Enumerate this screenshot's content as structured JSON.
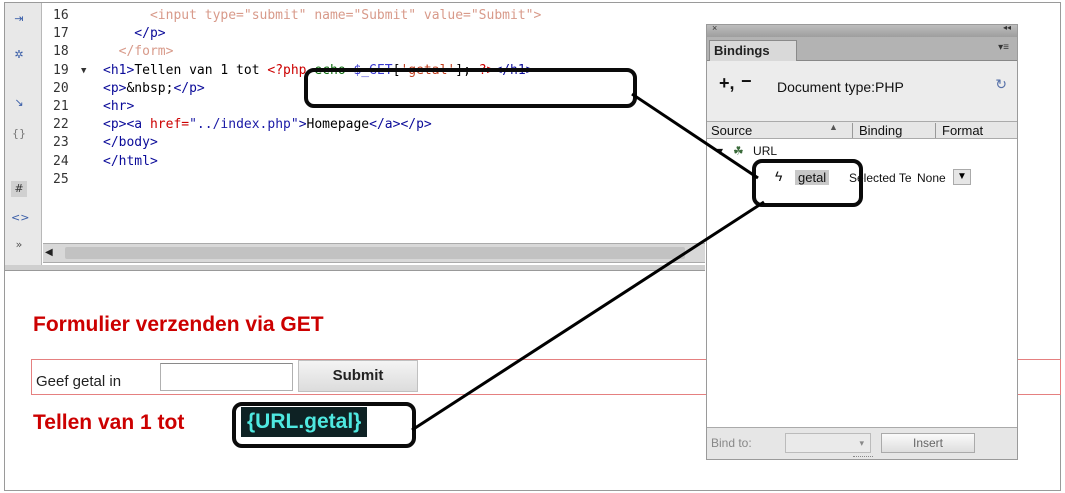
{
  "toolbar": {
    "icons": [
      "expand-icon",
      "collapse-icon",
      "select-parent-icon",
      "balance-braces-icon",
      "line-numbers-icon",
      "highlight-invalid-icon",
      "more-icon"
    ]
  },
  "code": {
    "lines": [
      {
        "num": "16",
        "parts": [
          [
            "faded",
            "      <input type=\"submit\" name=\"Submit\" value=\"Submit\">"
          ]
        ]
      },
      {
        "num": "17",
        "parts": [
          [
            "tag",
            "    </p>"
          ]
        ]
      },
      {
        "num": "18",
        "parts": [
          [
            "faded",
            "  </form>"
          ]
        ]
      },
      {
        "num": "19",
        "parts": [
          [
            "tag",
            "<h1>"
          ],
          [
            "plain",
            "Tellen van 1 tot "
          ],
          [
            "php",
            "<?php "
          ],
          [
            "phpfn",
            "echo "
          ],
          [
            "phpvar",
            "$_GET"
          ],
          [
            "plain",
            "["
          ],
          [
            "phpstr",
            "'getal'"
          ],
          [
            "plain",
            "]; "
          ],
          [
            "php",
            "?>"
          ],
          [
            "tag",
            "</h1>"
          ]
        ]
      },
      {
        "num": "20",
        "parts": [
          [
            "tag",
            "<p>"
          ],
          [
            "plain",
            "&nbsp;"
          ],
          [
            "tag",
            "</p>"
          ]
        ]
      },
      {
        "num": "21",
        "parts": [
          [
            "tag",
            "<hr>"
          ]
        ]
      },
      {
        "num": "22",
        "parts": [
          [
            "tag",
            "<p><a "
          ],
          [
            "kw",
            "href="
          ],
          [
            "str",
            "\"../index.php\""
          ],
          [
            "tag",
            ">"
          ],
          [
            "plain",
            "Homepage"
          ],
          [
            "tag",
            "</a></p>"
          ]
        ]
      },
      {
        "num": "23",
        "parts": [
          [
            "tag",
            "</body>"
          ]
        ]
      },
      {
        "num": "24",
        "parts": [
          [
            "tag",
            "</html>"
          ]
        ]
      },
      {
        "num": "25",
        "parts": []
      }
    ]
  },
  "design": {
    "heading": "Formulier verzenden via GET",
    "form_label": "Geef getal in",
    "form_input_value": "",
    "submit_label": "Submit",
    "result_prefix": "Tellen van 1 tot ",
    "result_token": "{URL.getal}"
  },
  "panel": {
    "title": "Bindings",
    "doc_type": "Document type:PHP",
    "add_label": "+,",
    "remove_label": "−",
    "columns": {
      "source": "Source",
      "binding": "Binding",
      "format": "Format"
    },
    "tree": {
      "url_label": "URL",
      "item": {
        "name": "getal",
        "binding": "Selected Te",
        "format": "None"
      }
    },
    "bind_to_label": "Bind to:",
    "bind_to_value": "",
    "insert_label": "Insert"
  }
}
